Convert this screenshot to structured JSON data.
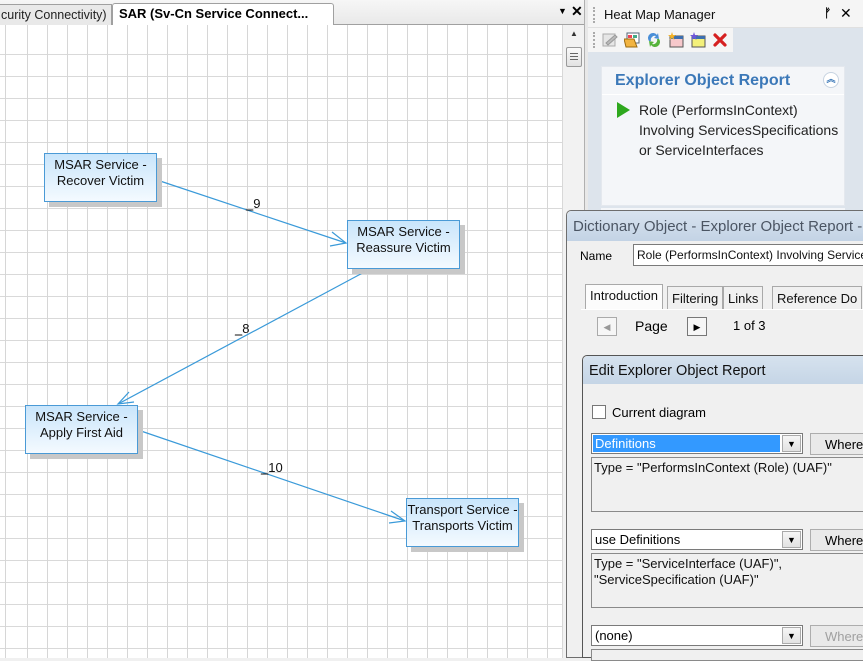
{
  "diagram": {
    "tabs": [
      {
        "label": "curity Connectivity)",
        "active": false
      },
      {
        "label": "SAR (Sv-Cn Service Connect...",
        "active": true
      }
    ],
    "nodes": [
      {
        "id": "recover",
        "line1": "MSAR Service -",
        "line2": "Recover Victim"
      },
      {
        "id": "reassure",
        "line1": "MSAR Service -",
        "line2": "Reassure Victim"
      },
      {
        "id": "firstaid",
        "line1": "MSAR Service -",
        "line2": "Apply First Aid"
      },
      {
        "id": "transport",
        "line1": "Transport Service -",
        "line2": "Transports Victim"
      }
    ],
    "edges": [
      {
        "from": "recover",
        "to": "reassure",
        "label": "_9"
      },
      {
        "from": "reassure",
        "to": "firstaid",
        "label": "_8"
      },
      {
        "from": "firstaid",
        "to": "transport",
        "label": "_10"
      }
    ],
    "edge_color": "#3a9ad9"
  },
  "heatmap": {
    "title": "Heat Map Manager",
    "pin_glyph": "⫯",
    "close_glyph": "✕",
    "toolbar": [
      "edit-heatmap-icon",
      "open-heatmap-icon",
      "refresh-icon",
      "new-heatmap-icon",
      "new-heatmap-alt-icon",
      "delete-icon"
    ],
    "report_card": {
      "title": "Explorer Object Report",
      "collapse_glyph": "˄",
      "link": "Role (PerformsInContext) Involving ServicesSpecifications or ServiceInterfaces"
    }
  },
  "dictionary": {
    "title": "Dictionary Object - Explorer Object Report -",
    "name_label": "Name",
    "name_value": "Role (PerformsInContext) Involving ServicesSpecifications or ServiceInterfaces",
    "tabs": [
      "Introduction",
      "Filtering",
      "Links",
      "Reference Do"
    ],
    "active_tab": "Introduction",
    "page_label": "Page",
    "page_count": "1 of 3"
  },
  "edit": {
    "title": "Edit Explorer Object Report",
    "current_diagram_label": "Current diagram",
    "current_diagram_checked": false,
    "rows": [
      {
        "combo": "Definitions",
        "where": "Where",
        "expr": "Type = \"PerformsInContext (Role) (UAF)\"",
        "selected": true,
        "enabled": true
      },
      {
        "combo": "use Definitions",
        "where": "Where",
        "expr": "Type = \"ServiceInterface (UAF)\",\n\"ServiceSpecification (UAF)\"",
        "selected": false,
        "enabled": true
      },
      {
        "combo": "(none)",
        "where": "Where",
        "expr": "",
        "selected": false,
        "enabled": false
      }
    ]
  }
}
